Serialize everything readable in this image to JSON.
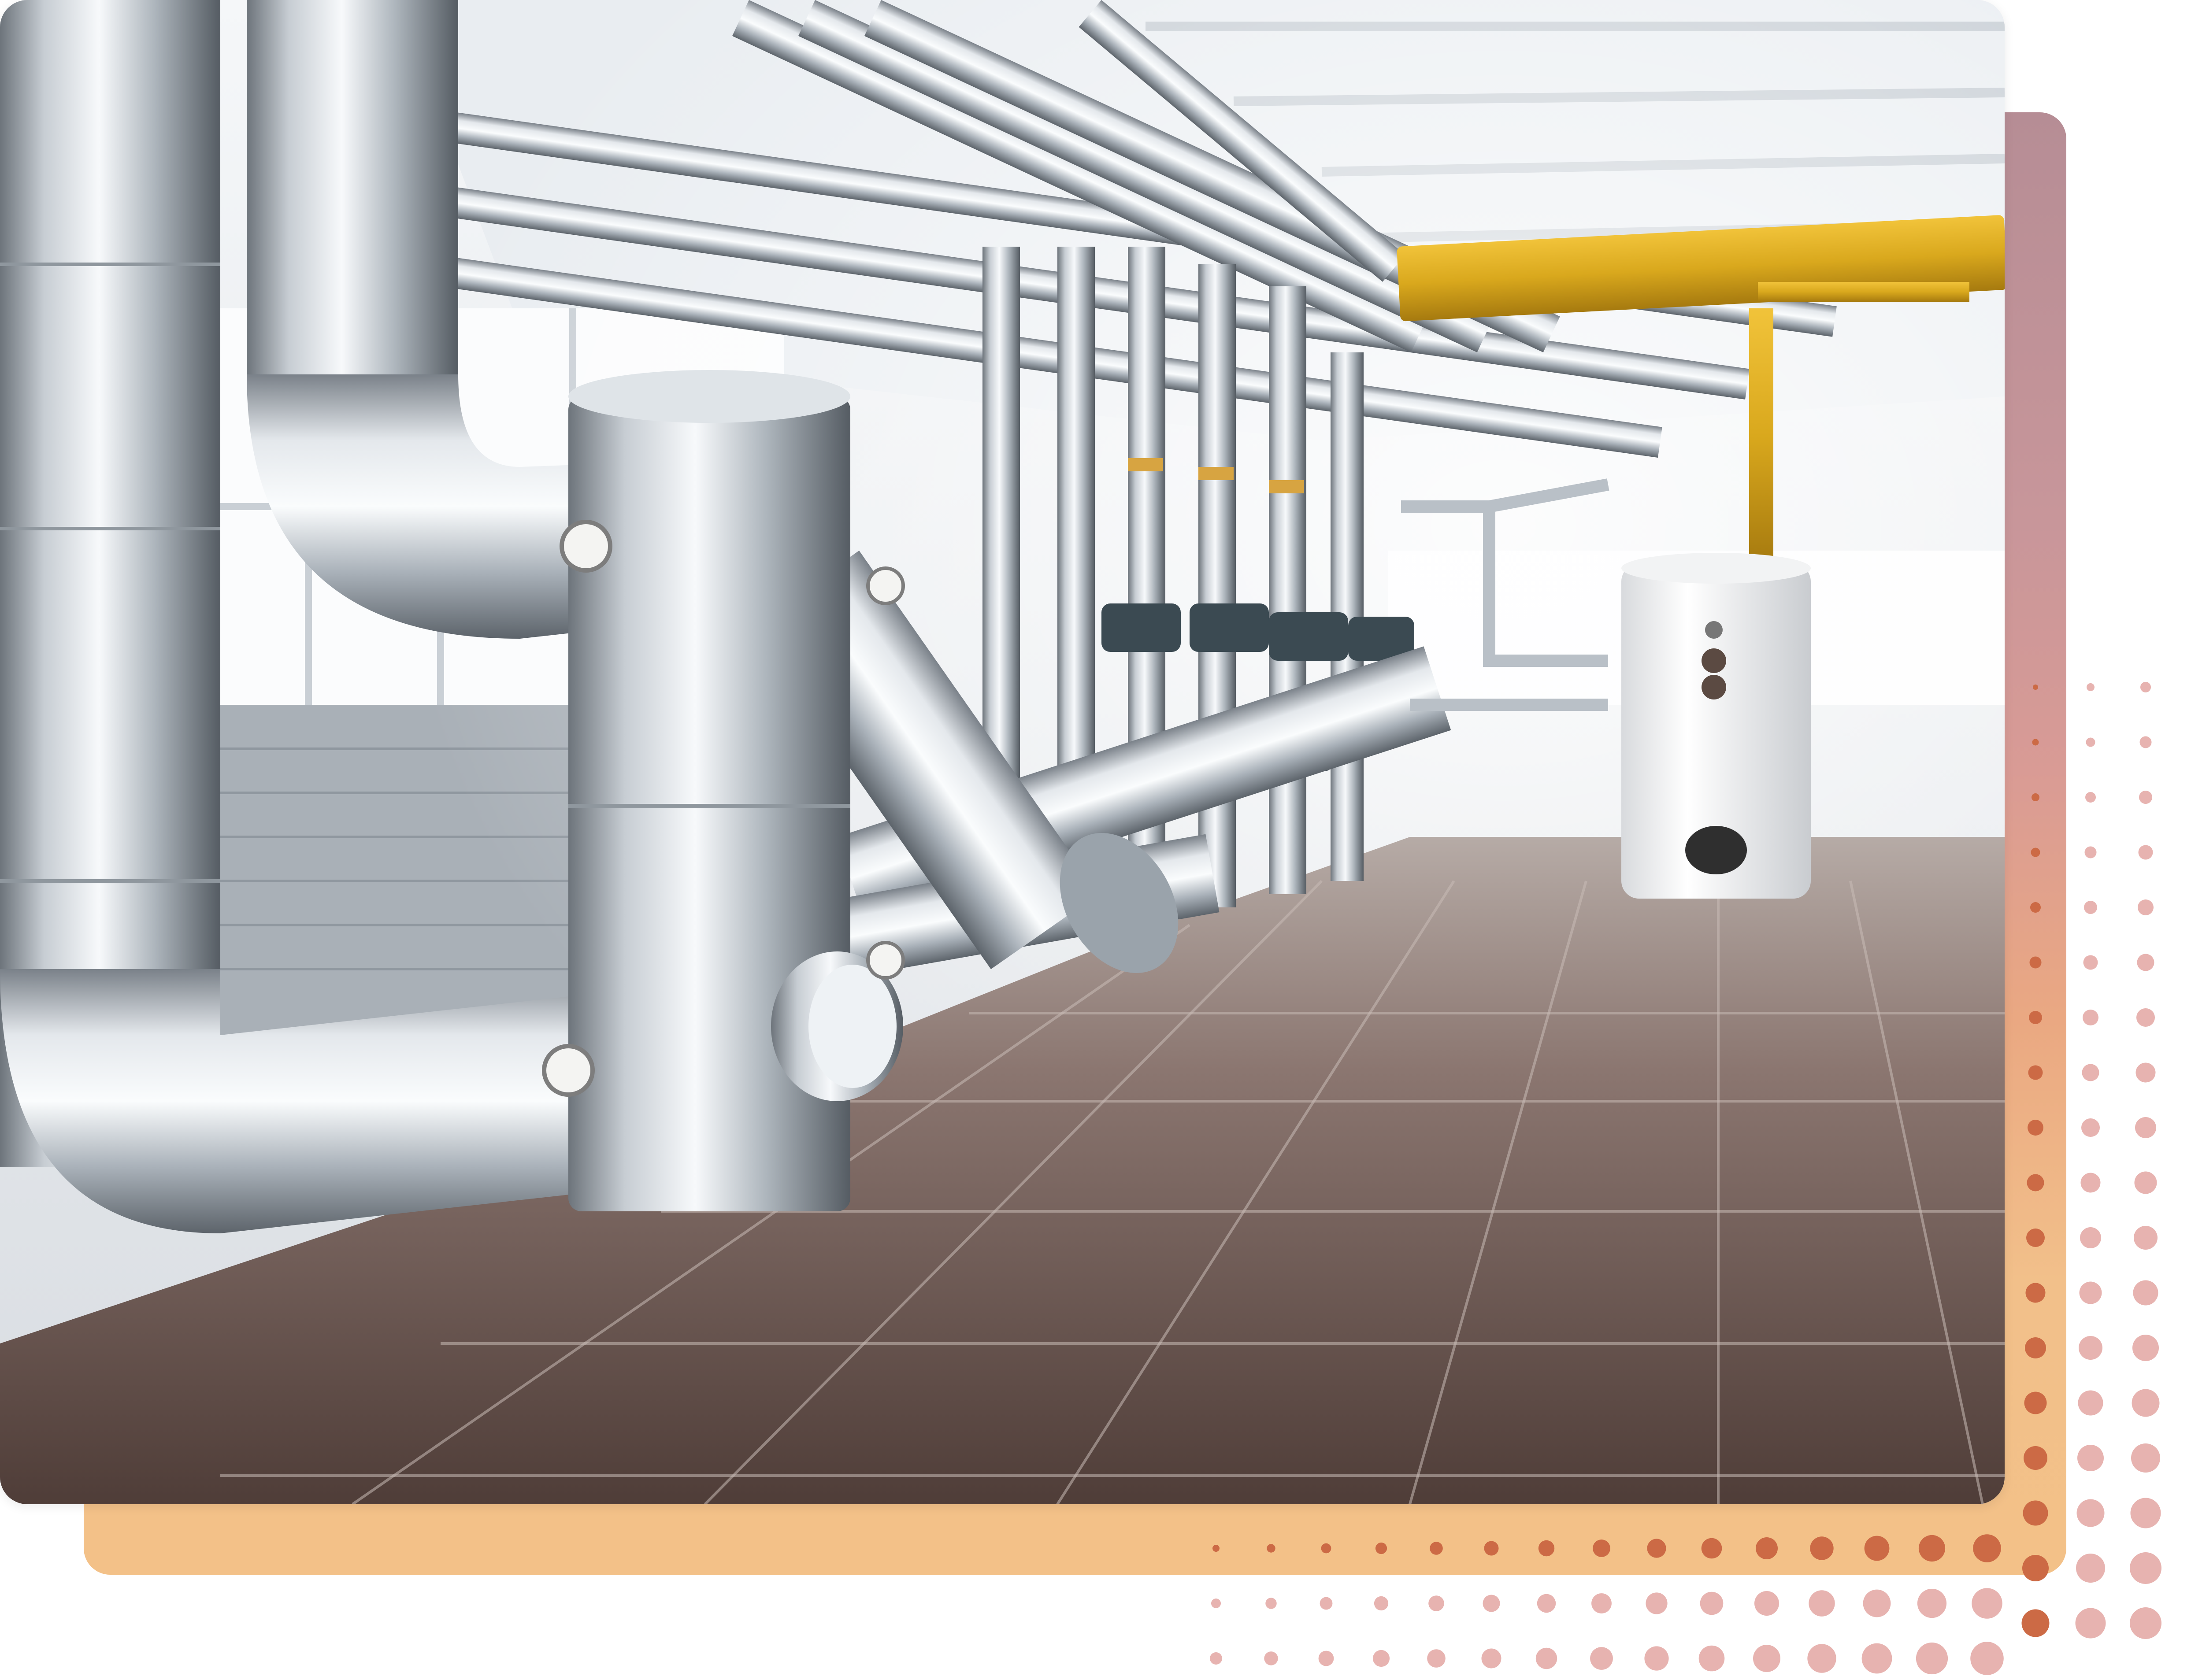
{
  "image": {
    "subject": "industrial-boiler-room",
    "accent_colors": {
      "backplate_top": "#b68d95",
      "backplate_mid": "#d99b95",
      "backplate_bottom": "#f3c188",
      "dot_dark": "#cc6a45",
      "dot_light": "#e7b3b0",
      "gas_pipe": "#d9a81d",
      "floor_tile": "#6d5a52"
    }
  }
}
